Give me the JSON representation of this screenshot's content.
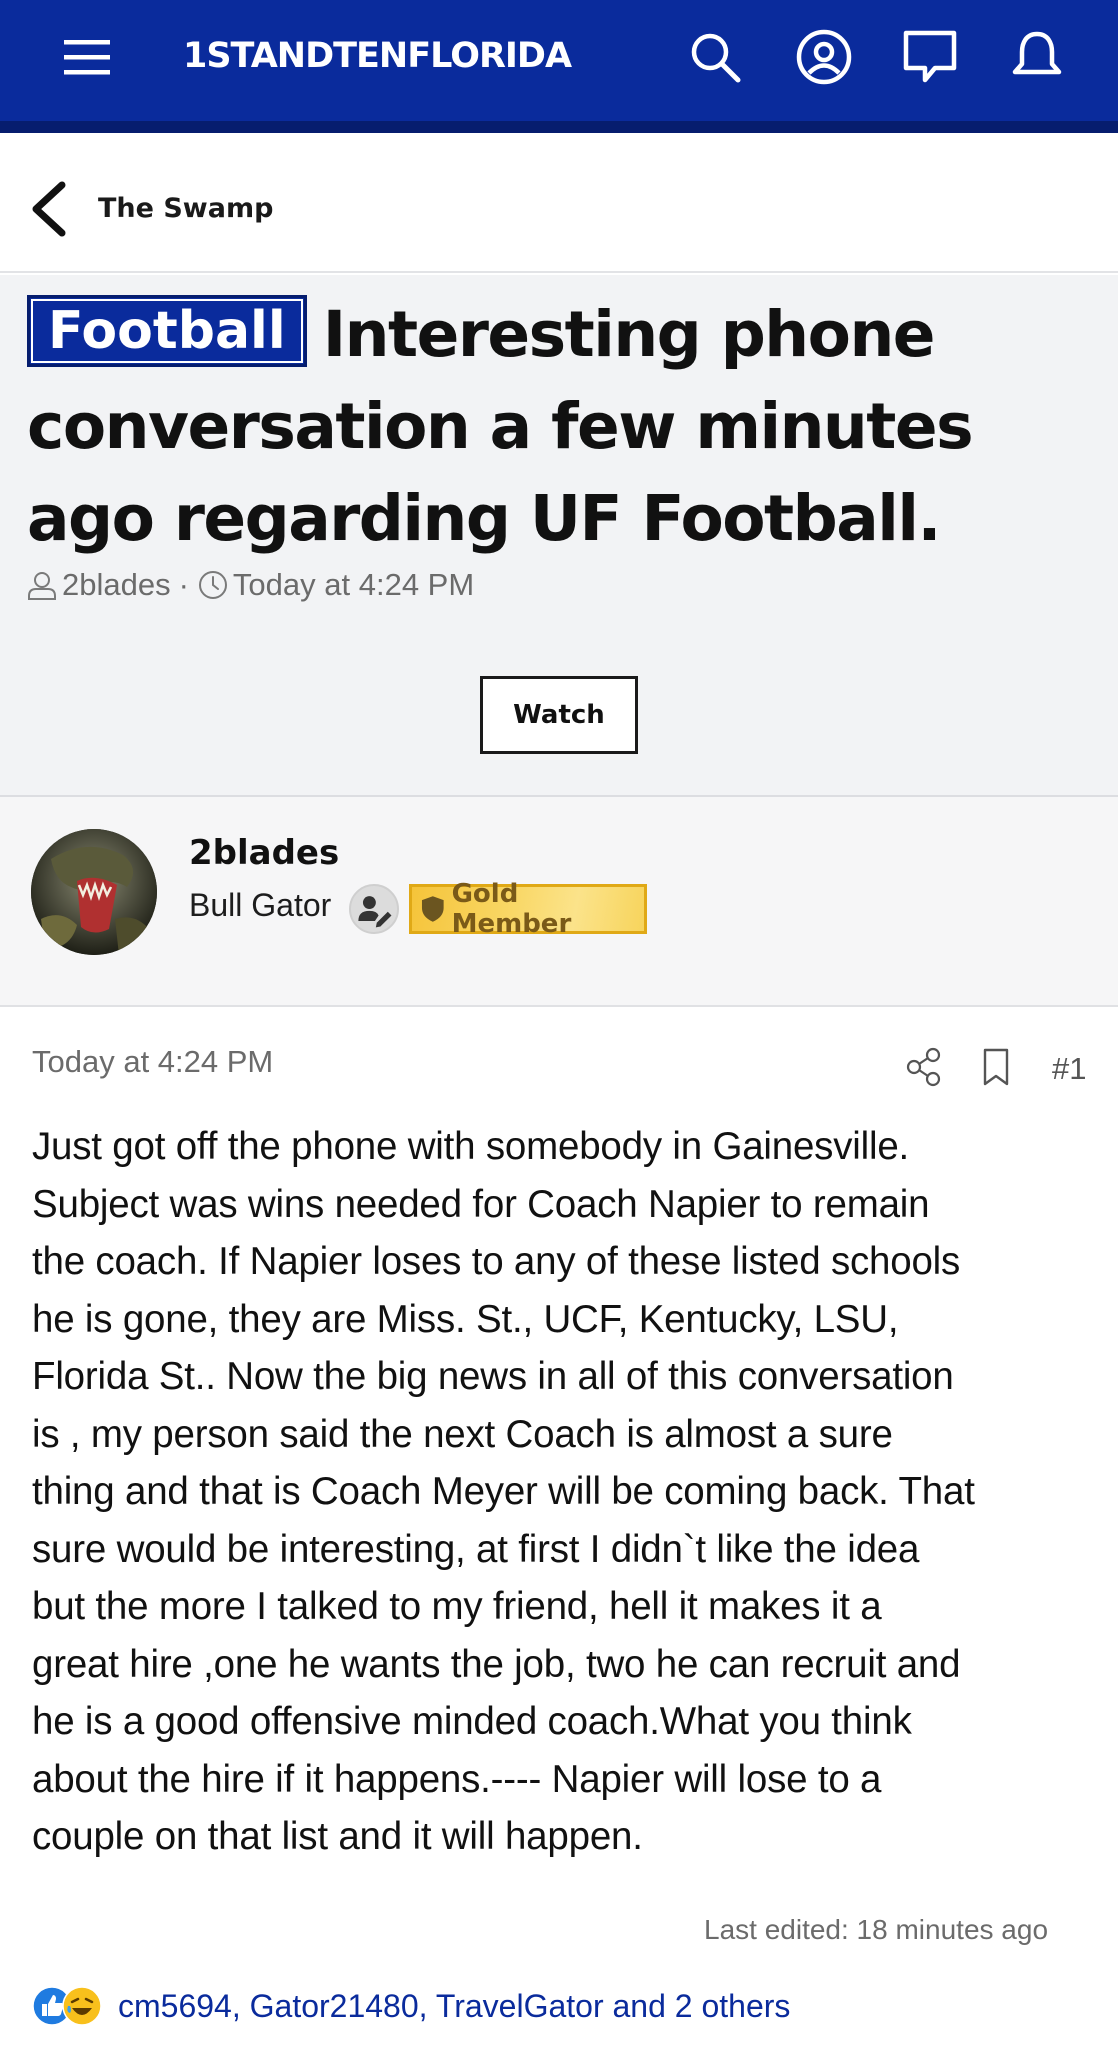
{
  "header": {
    "brand": "1STANDTENFLORIDA",
    "icons": [
      "menu-icon",
      "search-icon",
      "account-icon",
      "inbox-icon",
      "alerts-icon"
    ]
  },
  "breadcrumb": {
    "label": "The Swamp"
  },
  "thread": {
    "prefix": "Football",
    "title": "Interesting phone conversation a few minutes ago regarding UF Football.",
    "author": "2blades",
    "separator": "·",
    "date": "Today at 4:24 PM",
    "watch_label": "Watch"
  },
  "author_block": {
    "name": "2blades",
    "title": "Bull Gator",
    "badge": "Gold Member"
  },
  "post": {
    "date": "Today at 4:24 PM",
    "number": "#1",
    "lines": [
      "Just got off the phone with somebody in Gainesville.",
      "Subject was wins needed for Coach Napier to remain",
      "the coach. If Napier loses to any of these listed schools",
      "he is gone, they are Miss. St., UCF, Kentucky, LSU,",
      "Florida St.. Now the big news in all of this conversation",
      "is , my person said the next Coach is almost a sure",
      "thing and that is Coach Meyer will be coming back. That",
      "sure would be interesting, at first I didn`t like the idea",
      "but the more I talked to my friend, hell it makes it a",
      "great hire ,one he wants the job, two he can recruit and",
      "he is a good offensive minded coach.What you think",
      "about the hire if it happens.---- Napier will lose to a",
      "couple on that list and it will happen."
    ],
    "last_edited": "Last edited: 18 minutes ago"
  },
  "reactions": {
    "icons": [
      "like-icon",
      "laugh-icon"
    ],
    "text": "cm5694, Gator21480, TravelGator and 2 others"
  },
  "colors": {
    "brand_blue": "#0a2b9c",
    "gold": "#f5c43a"
  }
}
